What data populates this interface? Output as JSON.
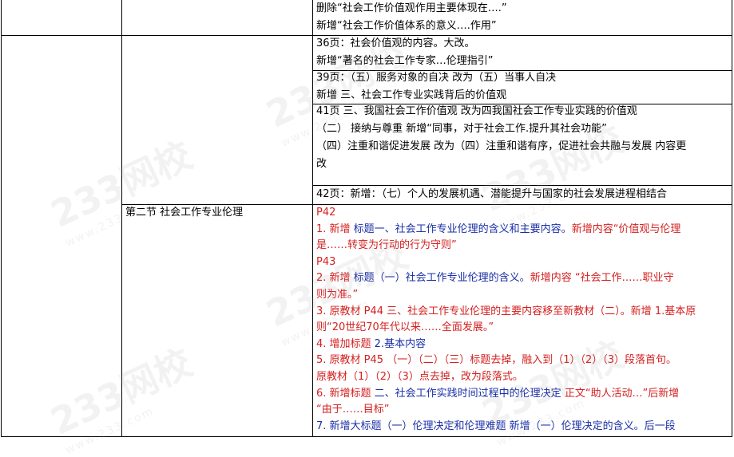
{
  "rows": {
    "r1": [
      "删除“社会工作价值观作用主要体现在….”",
      "新增“社会工作价值体系的意义….作用”"
    ],
    "r2": [
      "36页：社会价值观的内容。大改。",
      "新增“著名的社会工作专家…伦理指引”"
    ],
    "r3": [
      "39页：（五）服务对象的自决 改为（五）当事人自决",
      "新增 三、社会工作专业实践背后的价值观"
    ],
    "r4": [
      "41页 三、我国社会工作价值观 改为四我国社会工作专业实践的价值观",
      "（二） 接纳与尊重 新增“同事，对于社会工作.提升其社会功能”",
      "（四）注重和谐促进发展 改为（四）注重和谐有序，促进社会共融与发展 内容更",
      "改"
    ],
    "r5": [
      "42页：新增：（七）个人的发展机遇、潜能提升与国家的社会发展进程相结合"
    ]
  },
  "section_label": "第二节 社会工作专业伦理",
  "section_items": {
    "p42": "P42",
    "i1a_num": "1. 新增 ",
    "i1a_title": "标题一、社会工作专业伦理的含义和主要内容。",
    "i1a_tail": "新增内容“价值观与伦理",
    "i1b": "是……转变为行动的行为守则”",
    "p43": "P43",
    "i2a_num": "2. 新增 ",
    "i2a_title": "标题（一）社会工作专业伦理的含义。",
    "i2a_tail": "新增内容 “社会工作……职业守",
    "i2b": "则为准。”",
    "i3a": "3. 原教材 P44 三、社会工作专业伦理的主要内容移至新教材（二）。新增 1.基本原",
    "i3b": "则“20世纪70年代以来……全面发展。”",
    "i4_num": "4. 增加标题 ",
    "i4_title": "2.基本内容",
    "i5_num": "5. 原教材 P45 ",
    "i5_title": "（一）（二）（三）标题去掉，融入到（1）（2）（3）段落首句。",
    "i5b": "原教材（1）（2）（3）点去掉，改为段落式。",
    "i6_num": "6. 新增标题 ",
    "i6_title": "二、社会工作实践时间过程中的伦理决定",
    "i6_tail": " 正文“助人活动…”后新增",
    "i6b": "“由于……目标”",
    "i7_num": "7. 新增大标题（一）伦理决定和伦理难题 ",
    "i7_tail": "新增（一）伦理决定的含义。后一段"
  },
  "watermark": {
    "brand": "233网校",
    "url": "www.233.com"
  },
  "colors": {
    "red": "#d42020",
    "blue": "#1a2fa6"
  }
}
